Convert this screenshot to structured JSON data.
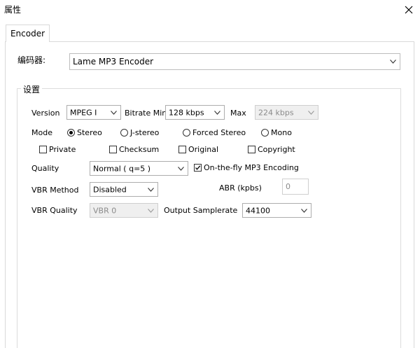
{
  "window": {
    "title": "属性"
  },
  "tabs": [
    {
      "label": "Encoder"
    }
  ],
  "encoder": {
    "label": "编码器:",
    "value": "Lame MP3 Encoder"
  },
  "settings": {
    "group_label": "设置",
    "version": {
      "label": "Version",
      "value": "MPEG I"
    },
    "bitrate_min": {
      "label": "Bitrate Min",
      "value": "128 kbps"
    },
    "bitrate_max": {
      "label": "Max",
      "value": "224 kbps"
    },
    "mode": {
      "label": "Mode",
      "options": [
        {
          "label": "Stereo",
          "selected": true
        },
        {
          "label": "J-stereo",
          "selected": false
        },
        {
          "label": "Forced Stereo",
          "selected": false
        },
        {
          "label": "Mono",
          "selected": false
        }
      ]
    },
    "flags": [
      {
        "label": "Private",
        "checked": false
      },
      {
        "label": "Checksum",
        "checked": false
      },
      {
        "label": "Original",
        "checked": false
      },
      {
        "label": "Copyright",
        "checked": false
      }
    ],
    "quality": {
      "label": "Quality",
      "value": "Normal ( q=5 )"
    },
    "on_the_fly": {
      "label": "On-the-fly MP3 Encoding",
      "checked": true
    },
    "vbr_method": {
      "label": "VBR Method",
      "value": "Disabled"
    },
    "abr": {
      "label": "ABR (kpbs)",
      "value": "0"
    },
    "vbr_quality": {
      "label": "VBR Quality",
      "value": "VBR 0"
    },
    "output_samplerate": {
      "label": "Output Samplerate",
      "value": "44100"
    }
  }
}
